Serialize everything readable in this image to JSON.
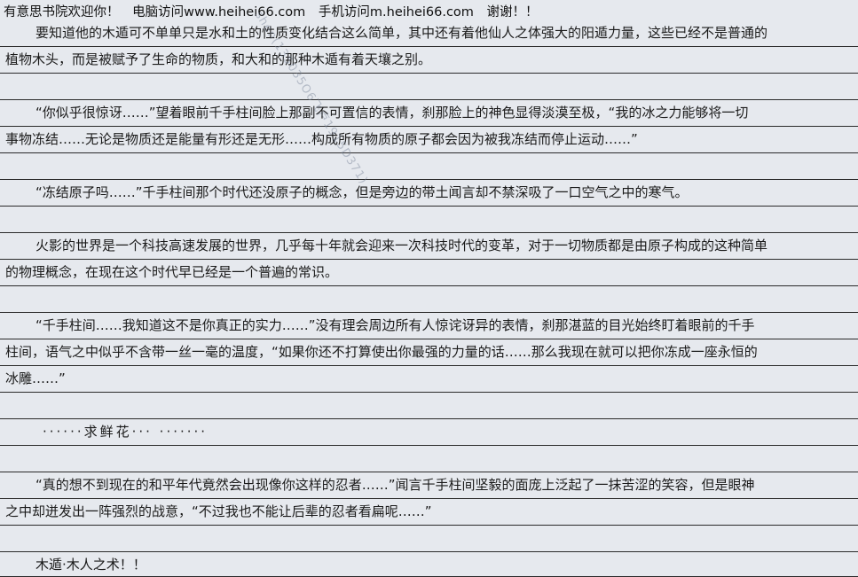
{
  "header": {
    "welcome": "有意思书院欢迎你！",
    "pc": "电脑访问www.heihei66.com",
    "mobile": "手机访问m.heihei66.com",
    "thanks": "谢谢！！"
  },
  "watermark": "shen(135035O6飞卢1915D371)",
  "lines": [
    "要知道他的木遁可不单单只是水和土的性质变化结合这么简单，其中还有着他仙人之体强大的阳遁力量，这些已经不是普通的",
    "植物木头，而是被赋予了生命的物质，和大和的那种木遁有着天壤之别。",
    "",
    "“你似乎很惊讶……”望着眼前千手柱间脸上那副不可置信的表情，刹那脸上的神色显得淡漠至极，“我的冰之力能够将一切",
    "事物冻结……无论是物质还是能量有形还是无形……构成所有物质的原子都会因为被我冻结而停止运动……”",
    "",
    "“冻结原子吗……”千手柱间那个时代还没原子的概念，但是旁边的带土闻言却不禁深吸了一口空气之中的寒气。",
    "",
    "火影的世界是一个科技高速发展的世界，几乎每十年就会迎来一次科技时代的变革，对于一切物质都是由原子构成的这种简单",
    "的物理概念，在现在这个时代早已经是一个普遍的常识。",
    "",
    "“千手柱间……我知道这不是你真正的实力……”没有理会周边所有人惊诧讶异的表情，刹那湛蓝的目光始终盯着眼前的千手",
    "柱间，语气之中似乎不含带一丝一毫的温度，“如果你还不打算使出你最强的力量的话……那么我现在就可以把你冻成一座永恒的",
    "冰雕……”",
    "",
    "······求鲜花···  ·······",
    "",
    "“真的想不到现在的和平年代竟然会出现像你这样的忍者……”闻言千手柱间坚毅的面庞上泛起了一抹苦涩的笑容，但是眼神",
    "之中却迸发出一阵强烈的战意，“不过我也不能让后辈的忍者看扁呢……”",
    "",
    "木遁·木人之术！！"
  ]
}
